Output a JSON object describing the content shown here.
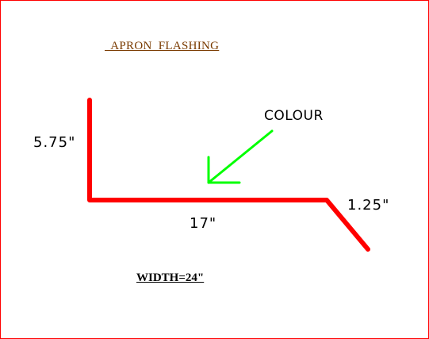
{
  "title": "  APRON  FLASHING",
  "labels": {
    "colour": "COLOUR",
    "height_dim": "5.75\"",
    "base_dim": "17\"",
    "kick_dim": "1.25\"",
    "width_note": "WIDTH=24\""
  },
  "colors": {
    "profile": "#ff0000",
    "arrow": "#00ff00",
    "title": "#7a3b00",
    "border": "#ff0000"
  }
}
